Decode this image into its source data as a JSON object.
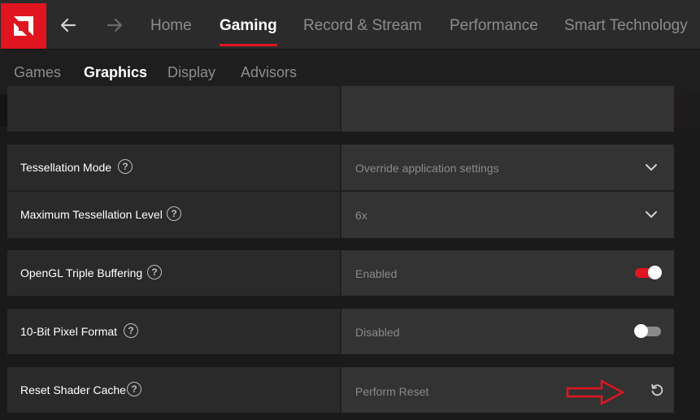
{
  "app": {
    "logo_icon": "amd-logo-icon",
    "accent_color": "#e0151f"
  },
  "nav": {
    "back_icon": "arrow-left-icon",
    "forward_icon": "arrow-right-icon"
  },
  "main_tabs": [
    {
      "label": "Home",
      "active": false
    },
    {
      "label": "Gaming",
      "active": true
    },
    {
      "label": "Record & Stream",
      "active": false
    },
    {
      "label": "Performance",
      "active": false
    },
    {
      "label": "Smart Technology",
      "active": false
    }
  ],
  "sub_tabs": [
    {
      "label": "Games",
      "active": false
    },
    {
      "label": "Graphics",
      "active": true
    },
    {
      "label": "Display",
      "active": false
    },
    {
      "label": "Advisors",
      "active": false
    }
  ],
  "settings": {
    "tessellation_mode": {
      "label": "Tessellation Mode",
      "value": "Override application settings",
      "control": "dropdown"
    },
    "max_tessellation_level": {
      "label": "Maximum Tessellation Level",
      "value": "6x",
      "control": "dropdown"
    },
    "opengl_triple_buffering": {
      "label": "OpenGL Triple Buffering",
      "value": "Enabled",
      "control": "toggle",
      "on": true
    },
    "ten_bit_pixel_format": {
      "label": "10-Bit Pixel Format",
      "value": "Disabled",
      "control": "toggle",
      "on": false
    },
    "reset_shader_cache": {
      "label": "Reset Shader Cache",
      "value": "Perform Reset",
      "control": "reset-button"
    }
  },
  "help_glyph": "?"
}
